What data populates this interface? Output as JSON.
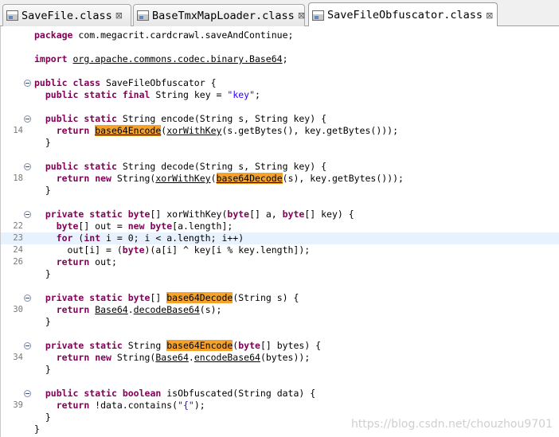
{
  "tabs": [
    {
      "label": "SaveFile.class",
      "close": "⊠"
    },
    {
      "label": "BaseTmxMapLoader.class",
      "close": "⊠"
    },
    {
      "label": "SaveFileObfuscator.class",
      "close": "⊠"
    }
  ],
  "line_numbers": {
    "l14": "14",
    "l18": "18",
    "l22": "22",
    "l23": "23",
    "l24": "24",
    "l26": "26",
    "l30": "30",
    "l34": "34",
    "l39": "39"
  },
  "code": {
    "package_kw": "package",
    "package_name": " com.megacrit.cardcrawl.saveAndContinue;",
    "import_kw": "import",
    "import_name": "org.apache.commons.codec.binary.Base64",
    "semicolon": ";",
    "public": "public",
    "static": "static",
    "final": "final",
    "class": "class",
    "return": "return",
    "new": "new",
    "private": "private",
    "byte": "byte",
    "for": "for",
    "int": "int",
    "boolean": "boolean",
    "class_name": " SaveFileObfuscator {",
    "key_decl": " String key = ",
    "key_value": "\"key\"",
    "encode_sig": " String encode(String s, String key) {",
    "base64Encode": "base64Encode",
    "base64Decode": "base64Decode",
    "xorWithKey": "xorWithKey",
    "encode_body_rest": "(s.getBytes(), key.getBytes()));",
    "close_brace": "}",
    "decode_sig": " String decode(String s, String key) {",
    "decode_new_string": " String(",
    "decode_body_rest": "(s), key.getBytes()));",
    "xor_sig_mid": "[] xorWithKey(",
    "xor_sig_a": "[] a, ",
    "xor_sig_key": "[] key) {",
    "out_decl": "[] out = ",
    "out_new_tail": "[a.length];",
    "for_open": " (",
    "for_rest": " i = 0; i < a.length; i++)",
    "assign_start": "out[i] = (",
    "assign_rest": ")(a[i] ^ key[i % key.length]);",
    "return_out": " out;",
    "decode_sig_rest": "(String s) {",
    "base64_class": "Base64",
    "decodeBase64": "decodeBase64",
    "decode_call_rest": "(s);",
    "string_type": " String ",
    "encode_sig_rest": "[] bytes) {",
    "encodeBase64": "encodeBase64",
    "encode_call_rest": "(bytes));",
    "is_obf_sig": " isObfuscated(String data) {",
    "contains_start": " !data.contains(",
    "contains_arg": "\"{\"",
    "contains_end": ");",
    "byte_arr": "[] ",
    "dot": ".",
    "paren": "(",
    "sp": " ",
    "new_string_call": " String(",
    "close_paren": ")"
  },
  "watermark": "https://blog.csdn.net/chouzhou9701",
  "colors": {
    "keyword": "#7f0055",
    "string": "#2a00ff",
    "highlight": "#f4a22c",
    "current_line": "#e8f2fe"
  }
}
